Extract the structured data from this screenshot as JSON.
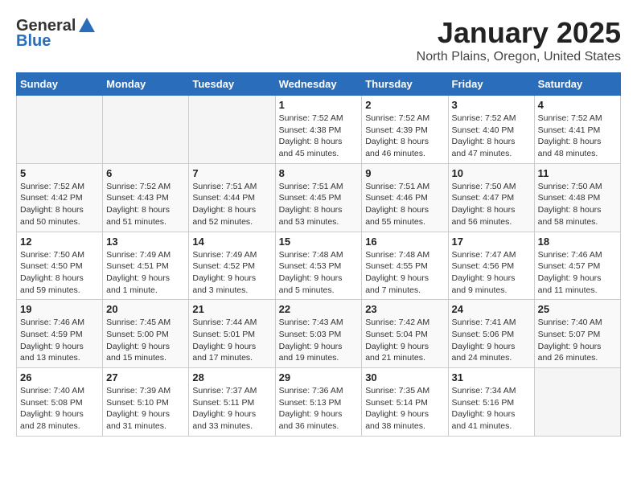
{
  "header": {
    "logo_general": "General",
    "logo_blue": "Blue",
    "month_title": "January 2025",
    "location": "North Plains, Oregon, United States"
  },
  "weekdays": [
    "Sunday",
    "Monday",
    "Tuesday",
    "Wednesday",
    "Thursday",
    "Friday",
    "Saturday"
  ],
  "weeks": [
    [
      {
        "day": "",
        "sunrise": "",
        "sunset": "",
        "daylight": ""
      },
      {
        "day": "",
        "sunrise": "",
        "sunset": "",
        "daylight": ""
      },
      {
        "day": "",
        "sunrise": "",
        "sunset": "",
        "daylight": ""
      },
      {
        "day": "1",
        "sunrise": "Sunrise: 7:52 AM",
        "sunset": "Sunset: 4:38 PM",
        "daylight": "Daylight: 8 hours and 45 minutes."
      },
      {
        "day": "2",
        "sunrise": "Sunrise: 7:52 AM",
        "sunset": "Sunset: 4:39 PM",
        "daylight": "Daylight: 8 hours and 46 minutes."
      },
      {
        "day": "3",
        "sunrise": "Sunrise: 7:52 AM",
        "sunset": "Sunset: 4:40 PM",
        "daylight": "Daylight: 8 hours and 47 minutes."
      },
      {
        "day": "4",
        "sunrise": "Sunrise: 7:52 AM",
        "sunset": "Sunset: 4:41 PM",
        "daylight": "Daylight: 8 hours and 48 minutes."
      }
    ],
    [
      {
        "day": "5",
        "sunrise": "Sunrise: 7:52 AM",
        "sunset": "Sunset: 4:42 PM",
        "daylight": "Daylight: 8 hours and 50 minutes."
      },
      {
        "day": "6",
        "sunrise": "Sunrise: 7:52 AM",
        "sunset": "Sunset: 4:43 PM",
        "daylight": "Daylight: 8 hours and 51 minutes."
      },
      {
        "day": "7",
        "sunrise": "Sunrise: 7:51 AM",
        "sunset": "Sunset: 4:44 PM",
        "daylight": "Daylight: 8 hours and 52 minutes."
      },
      {
        "day": "8",
        "sunrise": "Sunrise: 7:51 AM",
        "sunset": "Sunset: 4:45 PM",
        "daylight": "Daylight: 8 hours and 53 minutes."
      },
      {
        "day": "9",
        "sunrise": "Sunrise: 7:51 AM",
        "sunset": "Sunset: 4:46 PM",
        "daylight": "Daylight: 8 hours and 55 minutes."
      },
      {
        "day": "10",
        "sunrise": "Sunrise: 7:50 AM",
        "sunset": "Sunset: 4:47 PM",
        "daylight": "Daylight: 8 hours and 56 minutes."
      },
      {
        "day": "11",
        "sunrise": "Sunrise: 7:50 AM",
        "sunset": "Sunset: 4:48 PM",
        "daylight": "Daylight: 8 hours and 58 minutes."
      }
    ],
    [
      {
        "day": "12",
        "sunrise": "Sunrise: 7:50 AM",
        "sunset": "Sunset: 4:50 PM",
        "daylight": "Daylight: 8 hours and 59 minutes."
      },
      {
        "day": "13",
        "sunrise": "Sunrise: 7:49 AM",
        "sunset": "Sunset: 4:51 PM",
        "daylight": "Daylight: 9 hours and 1 minute."
      },
      {
        "day": "14",
        "sunrise": "Sunrise: 7:49 AM",
        "sunset": "Sunset: 4:52 PM",
        "daylight": "Daylight: 9 hours and 3 minutes."
      },
      {
        "day": "15",
        "sunrise": "Sunrise: 7:48 AM",
        "sunset": "Sunset: 4:53 PM",
        "daylight": "Daylight: 9 hours and 5 minutes."
      },
      {
        "day": "16",
        "sunrise": "Sunrise: 7:48 AM",
        "sunset": "Sunset: 4:55 PM",
        "daylight": "Daylight: 9 hours and 7 minutes."
      },
      {
        "day": "17",
        "sunrise": "Sunrise: 7:47 AM",
        "sunset": "Sunset: 4:56 PM",
        "daylight": "Daylight: 9 hours and 9 minutes."
      },
      {
        "day": "18",
        "sunrise": "Sunrise: 7:46 AM",
        "sunset": "Sunset: 4:57 PM",
        "daylight": "Daylight: 9 hours and 11 minutes."
      }
    ],
    [
      {
        "day": "19",
        "sunrise": "Sunrise: 7:46 AM",
        "sunset": "Sunset: 4:59 PM",
        "daylight": "Daylight: 9 hours and 13 minutes."
      },
      {
        "day": "20",
        "sunrise": "Sunrise: 7:45 AM",
        "sunset": "Sunset: 5:00 PM",
        "daylight": "Daylight: 9 hours and 15 minutes."
      },
      {
        "day": "21",
        "sunrise": "Sunrise: 7:44 AM",
        "sunset": "Sunset: 5:01 PM",
        "daylight": "Daylight: 9 hours and 17 minutes."
      },
      {
        "day": "22",
        "sunrise": "Sunrise: 7:43 AM",
        "sunset": "Sunset: 5:03 PM",
        "daylight": "Daylight: 9 hours and 19 minutes."
      },
      {
        "day": "23",
        "sunrise": "Sunrise: 7:42 AM",
        "sunset": "Sunset: 5:04 PM",
        "daylight": "Daylight: 9 hours and 21 minutes."
      },
      {
        "day": "24",
        "sunrise": "Sunrise: 7:41 AM",
        "sunset": "Sunset: 5:06 PM",
        "daylight": "Daylight: 9 hours and 24 minutes."
      },
      {
        "day": "25",
        "sunrise": "Sunrise: 7:40 AM",
        "sunset": "Sunset: 5:07 PM",
        "daylight": "Daylight: 9 hours and 26 minutes."
      }
    ],
    [
      {
        "day": "26",
        "sunrise": "Sunrise: 7:40 AM",
        "sunset": "Sunset: 5:08 PM",
        "daylight": "Daylight: 9 hours and 28 minutes."
      },
      {
        "day": "27",
        "sunrise": "Sunrise: 7:39 AM",
        "sunset": "Sunset: 5:10 PM",
        "daylight": "Daylight: 9 hours and 31 minutes."
      },
      {
        "day": "28",
        "sunrise": "Sunrise: 7:37 AM",
        "sunset": "Sunset: 5:11 PM",
        "daylight": "Daylight: 9 hours and 33 minutes."
      },
      {
        "day": "29",
        "sunrise": "Sunrise: 7:36 AM",
        "sunset": "Sunset: 5:13 PM",
        "daylight": "Daylight: 9 hours and 36 minutes."
      },
      {
        "day": "30",
        "sunrise": "Sunrise: 7:35 AM",
        "sunset": "Sunset: 5:14 PM",
        "daylight": "Daylight: 9 hours and 38 minutes."
      },
      {
        "day": "31",
        "sunrise": "Sunrise: 7:34 AM",
        "sunset": "Sunset: 5:16 PM",
        "daylight": "Daylight: 9 hours and 41 minutes."
      },
      {
        "day": "",
        "sunrise": "",
        "sunset": "",
        "daylight": ""
      }
    ]
  ]
}
